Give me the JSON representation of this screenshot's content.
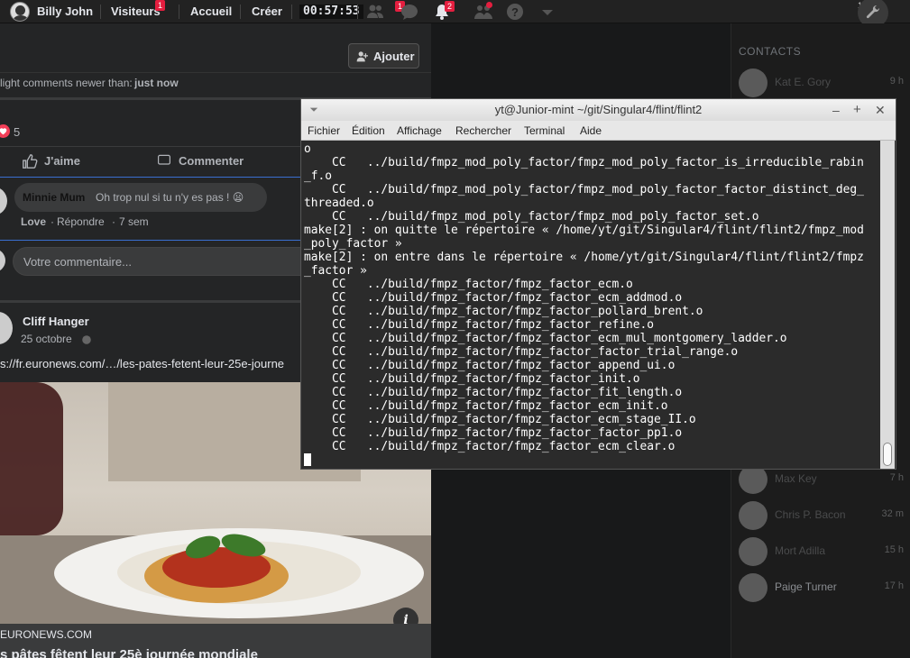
{
  "topbar": {
    "user_name": "Billy John",
    "visiteurs_label": "Visiteurs",
    "visiteurs_badge": "1",
    "home_label": "Accueil",
    "create_label": "Créer",
    "clock": "00:57:53",
    "friends_badge": "1",
    "notifications_badge": "2",
    "corner_count": "1"
  },
  "feed": {
    "add_button": "Ajouter",
    "highlight_prefix": "light comments newer than:",
    "highlight_value": "just now",
    "reactions_count": "5",
    "like_label": "J'aime",
    "comment_label": "Commenter",
    "comment": {
      "author": "Minnie Mum",
      "text": "Oh trop nul si tu n'y es pas ! 😦",
      "reaction": "Love",
      "reply": "Répondre",
      "age": "7 sem"
    },
    "comment_placeholder": "Votre commentaire...",
    "post": {
      "author": "Cliff Hanger",
      "date": "25 octobre",
      "link": "s://fr.euronews.com/…/les-pates-fetent-leur-25e-journe",
      "source": "EURONEWS.COM",
      "headline": "s pâtes fêtent leur 25è journée mondiale"
    }
  },
  "contacts": {
    "header": "CONTACTS",
    "items": [
      {
        "name": "Kat E. Gory",
        "time": "9 h"
      },
      {
        "name": "Max Key",
        "time": "7 h"
      },
      {
        "name": "Chris P. Bacon",
        "time": "32 m"
      },
      {
        "name": "Mort Adilla",
        "time": "15 h"
      },
      {
        "name": "Paige Turner",
        "time": "17 h"
      }
    ]
  },
  "terminal": {
    "title": "yt@Junior-mint ~/git/Singular4/flint/flint2",
    "menu": [
      "Fichier",
      "Édition",
      "Affichage",
      "Rechercher",
      "Terminal",
      "Aide"
    ],
    "lines": [
      "o",
      "    CC   ../build/fmpz_mod_poly_factor/fmpz_mod_poly_factor_is_irreducible_rabin",
      "_f.o",
      "    CC   ../build/fmpz_mod_poly_factor/fmpz_mod_poly_factor_factor_distinct_deg_",
      "threaded.o",
      "    CC   ../build/fmpz_mod_poly_factor/fmpz_mod_poly_factor_set.o",
      "make[2] : on quitte le répertoire « /home/yt/git/Singular4/flint/flint2/fmpz_mod",
      "_poly_factor »",
      "make[2] : on entre dans le répertoire « /home/yt/git/Singular4/flint/flint2/fmpz",
      "_factor »",
      "    CC   ../build/fmpz_factor/fmpz_factor_ecm.o",
      "    CC   ../build/fmpz_factor/fmpz_factor_ecm_addmod.o",
      "    CC   ../build/fmpz_factor/fmpz_factor_pollard_brent.o",
      "    CC   ../build/fmpz_factor/fmpz_factor_refine.o",
      "    CC   ../build/fmpz_factor/fmpz_factor_ecm_mul_montgomery_ladder.o",
      "    CC   ../build/fmpz_factor/fmpz_factor_factor_trial_range.o",
      "    CC   ../build/fmpz_factor/fmpz_factor_append_ui.o",
      "    CC   ../build/fmpz_factor/fmpz_factor_init.o",
      "    CC   ../build/fmpz_factor/fmpz_factor_fit_length.o",
      "    CC   ../build/fmpz_factor/fmpz_factor_ecm_init.o",
      "    CC   ../build/fmpz_factor/fmpz_factor_ecm_stage_II.o",
      "    CC   ../build/fmpz_factor/fmpz_factor_factor_pp1.o",
      "    CC   ../build/fmpz_factor/fmpz_factor_ecm_clear.o"
    ]
  }
}
